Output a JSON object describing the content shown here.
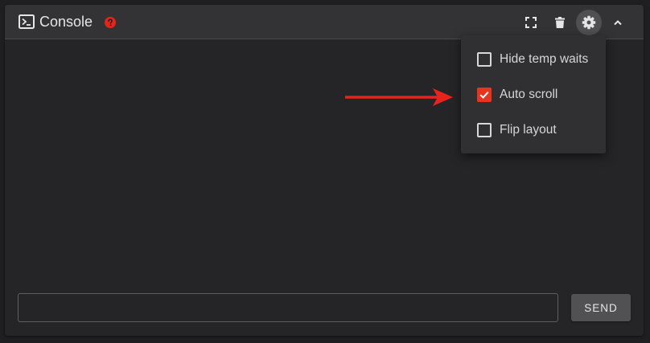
{
  "header": {
    "title": "Console",
    "icons": {
      "console": "terminal-icon",
      "help": "help-circle-icon",
      "fullscreen": "fullscreen-icon",
      "delete": "trash-icon",
      "settings": "gear-icon",
      "collapse": "chevron-up-icon"
    }
  },
  "settings_menu": {
    "items": [
      {
        "label": "Hide temp waits",
        "checked": false
      },
      {
        "label": "Auto scroll",
        "checked": true
      },
      {
        "label": "Flip layout",
        "checked": false
      }
    ]
  },
  "annotation": {
    "arrow_target": "Auto scroll",
    "arrow_color": "#e8231b"
  },
  "footer": {
    "input_value": "",
    "send_label": "SEND"
  },
  "colors": {
    "accent": "#e8331d",
    "background": "#252527",
    "header": "#333335"
  }
}
